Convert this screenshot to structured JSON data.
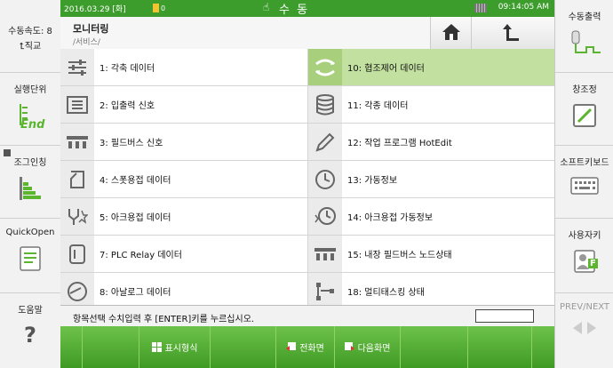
{
  "left_panel": {
    "speed_label": "수동속도: 8",
    "coord_label": "직교",
    "exec_unit_label": "실행단위",
    "exec_unit_icon_text": "End",
    "jog_label": "조그인칭",
    "quickopen_label": "QuickOpen",
    "help_label": "도움말",
    "help_icon_text": "?"
  },
  "right_panel": {
    "manual_output_label": "수동출력",
    "window_adjust_label": "창조정",
    "soft_keyboard_label": "소프트키보드",
    "user_char_label": "사용자키",
    "user_char_icon_text": "F",
    "prev_next_label": "PREV/NEXT"
  },
  "top_bar": {
    "date": "2016.03.29 [화]",
    "mode_indicator": "0",
    "mode": "수 동",
    "time": "09:14:05 AM"
  },
  "header": {
    "title": "모니터링",
    "breadcrumb": "/서비스/"
  },
  "menu": {
    "left": [
      {
        "label": "1: 각축 데이터",
        "icon": "axes-icon"
      },
      {
        "label": "2: 입출력 신호",
        "icon": "io-signal-icon"
      },
      {
        "label": "3: 필드버스 신호",
        "icon": "fieldbus-icon"
      },
      {
        "label": "4: 스폿용접 데이터",
        "icon": "spot-weld-icon"
      },
      {
        "label": "5: 아크용접 데이터",
        "icon": "arc-weld-icon"
      },
      {
        "label": "7: PLC Relay 데이터",
        "icon": "plc-relay-icon"
      },
      {
        "label": "8: 아날로그 데이터",
        "icon": "analog-gauge-icon"
      }
    ],
    "right": [
      {
        "label": "10: 협조제어 데이터",
        "icon": "cooperative-control-icon",
        "selected": true
      },
      {
        "label": "11: 각종 데이터",
        "icon": "database-icon"
      },
      {
        "label": "12: 작업 프로그램 HotEdit",
        "icon": "pencil-icon"
      },
      {
        "label": "13: 가동정보",
        "icon": "clock-icon"
      },
      {
        "label": "14: 아크용접 가동정보",
        "icon": "arc-clock-icon"
      },
      {
        "label": "15: 내장 필드버스 노드상태",
        "icon": "fieldbus-node-icon"
      },
      {
        "label": "18: 멀티태스킹 상태",
        "icon": "multitask-icon"
      }
    ]
  },
  "status": {
    "message": "항목선택 수치입력 후 [ENTER]키를 누르십시오.",
    "input_value": ""
  },
  "bottom_bar": {
    "display_format_label": "표시형식",
    "prev_screen_label": "전화면",
    "next_screen_label": "다음화면"
  },
  "colors": {
    "accent_green": "#3c9c2c",
    "selected_row": "#c2e0a0"
  }
}
